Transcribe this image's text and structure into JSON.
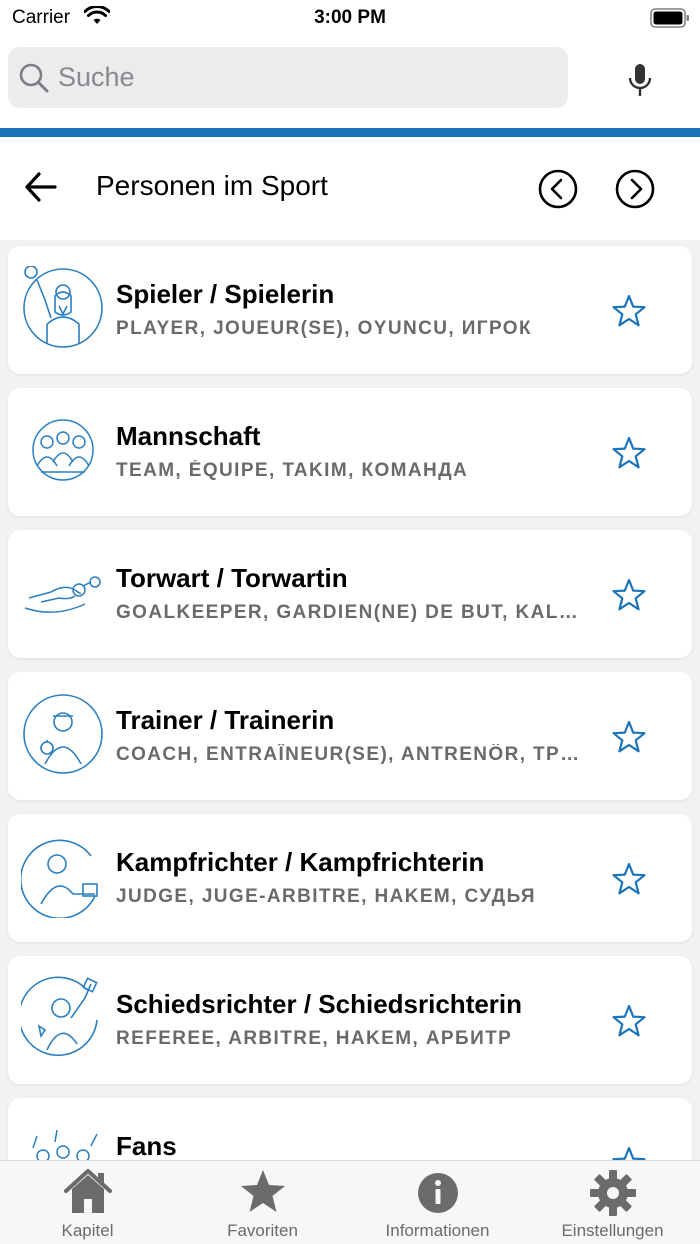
{
  "status_bar": {
    "carrier": "Carrier",
    "time": "3:00 PM"
  },
  "search": {
    "placeholder": "Suche",
    "value": ""
  },
  "header": {
    "title": "Personen im Sport"
  },
  "items": [
    {
      "title": "Spieler / Spielerin",
      "subtitle": "PLAYER, JOUEUR(SE), OYUNCU, ИГРОК",
      "icon": "player-pictogram-icon"
    },
    {
      "title": "Mannschaft",
      "subtitle": "TEAM, ÉQUIPE, TAKIM, КОМАНДА",
      "icon": "team-pictogram-icon"
    },
    {
      "title": "Torwart / Torwartin",
      "subtitle": "GOALKEEPER, GARDIEN(NE) DE BUT, KALECI, ВРАТАРЬ",
      "icon": "goalkeeper-pictogram-icon"
    },
    {
      "title": "Trainer / Trainerin",
      "subtitle": "COACH, ENTRAÎNEUR(SE), ANTRENÖR, ТРЕНЕР",
      "icon": "coach-pictogram-icon"
    },
    {
      "title": "Kampfrichter / Kampfrichterin",
      "subtitle": "JUDGE, JUGE-ARBITRE, HAKEM, СУДЬЯ",
      "icon": "judge-pictogram-icon"
    },
    {
      "title": "Schiedsrichter / Schiedsrichterin",
      "subtitle": "REFEREE, ARBITRE, HAKEM, АРБИТР",
      "icon": "referee-pictogram-icon"
    },
    {
      "title": "Fans",
      "subtitle": "",
      "icon": "fans-pictogram-icon"
    }
  ],
  "tabs": [
    {
      "label": "Kapitel",
      "icon": "home-icon"
    },
    {
      "label": "Favoriten",
      "icon": "star-icon"
    },
    {
      "label": "Informationen",
      "icon": "info-icon"
    },
    {
      "label": "Einstellungen",
      "icon": "gear-icon"
    }
  ],
  "colors": {
    "accent": "#1a74ba",
    "pictogram": "#2b7fc0",
    "tab_inactive": "#6b6b6b"
  }
}
